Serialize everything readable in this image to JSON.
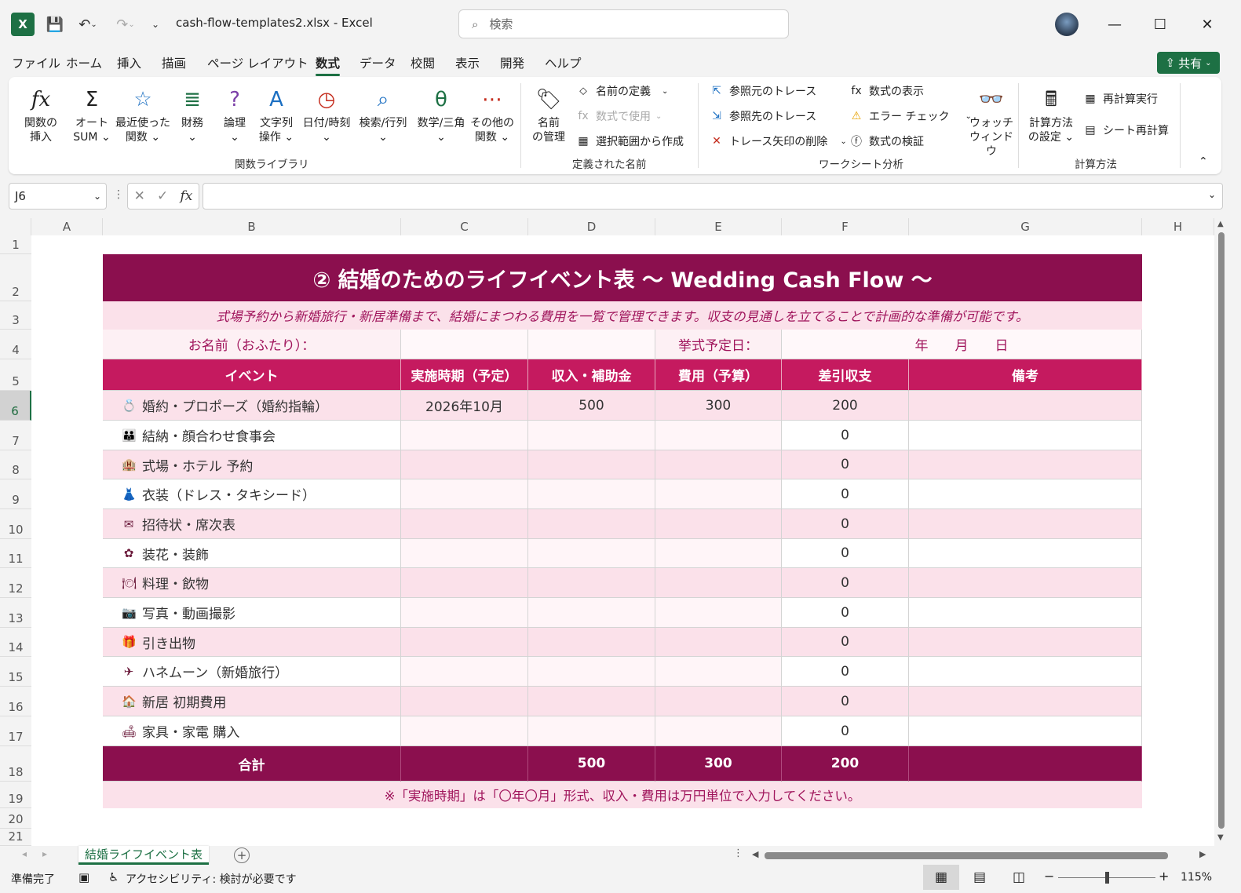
{
  "titlebar": {
    "file_title": "cash-flow-templates2.xlsx  -  Excel",
    "search_placeholder": "検索"
  },
  "menu": {
    "items": [
      "ファイル",
      "ホーム",
      "挿入",
      "描画",
      "ページ レイアウト",
      "数式",
      "データ",
      "校閲",
      "表示",
      "開発",
      "ヘルプ"
    ],
    "active": "数式",
    "share": "共有"
  },
  "ribbon": {
    "insert_function": [
      "関数の",
      "挿入"
    ],
    "autosum": [
      "オート",
      "SUM"
    ],
    "recent": [
      "最近使った",
      "関数"
    ],
    "financial": "財務",
    "logical": "論理",
    "text": [
      "文字列",
      "操作"
    ],
    "datetime": "日付/時刻",
    "lookup": "検索/行列",
    "math": "数学/三角",
    "more": [
      "その他の",
      "関数"
    ],
    "group_library": "関数ライブラリ",
    "name_manager": [
      "名前",
      "の管理"
    ],
    "define_name": "名前の定義",
    "use_in_formula": "数式で使用",
    "create_from_sel": "選択範囲から作成",
    "group_names": "定義された名前",
    "trace_precedents": "参照元のトレース",
    "trace_dependents": "参照先のトレース",
    "remove_arrows": "トレース矢印の削除",
    "show_formulas": "数式の表示",
    "error_check": "エラー チェック",
    "evaluate": "数式の検証",
    "watch": [
      "ウォッチ",
      "ウィンドウ"
    ],
    "group_audit": "ワークシート分析",
    "calc_options": [
      "計算方法",
      "の設定"
    ],
    "calc_now": "再計算実行",
    "calc_sheet": "シート再計算",
    "group_calc": "計算方法"
  },
  "formula_bar": {
    "name_box": "J6",
    "fx": "fx"
  },
  "columns": [
    "A",
    "B",
    "C",
    "D",
    "E",
    "F",
    "G",
    "H"
  ],
  "rows": [
    "1",
    "2",
    "3",
    "4",
    "5",
    "6",
    "7",
    "8",
    "9",
    "10",
    "11",
    "12",
    "13",
    "14",
    "15",
    "16",
    "17",
    "18",
    "19",
    "20",
    "21"
  ],
  "sheet": {
    "title": "② 結婚のためのライフイベント表 〜 Wedding Cash Flow 〜",
    "subtitle": "式場予約から新婚旅行・新居準備まで、結婚にまつわる費用を一覧で管理できます。収支の見通しを立てることで計画的な準備が可能です。",
    "name_label": "お名前（おふたり）：",
    "date_label": "挙式予定日：",
    "date_value": "年　　月　　日",
    "headers": [
      "イベント",
      "実施時期（予定）",
      "収入・補助金",
      "費用（予算）",
      "差引収支",
      "備考"
    ],
    "events": [
      {
        "icon": "💍",
        "name": "婚約・プロポーズ（婚約指輪）",
        "when": "2026年10月",
        "income": "500",
        "cost": "300",
        "balance": "200"
      },
      {
        "icon": "👪",
        "name": "結納・顔合わせ食事会",
        "when": "",
        "income": "",
        "cost": "",
        "balance": "0"
      },
      {
        "icon": "🏨",
        "name": "式場・ホテル 予約",
        "when": "",
        "income": "",
        "cost": "",
        "balance": "0"
      },
      {
        "icon": "👗",
        "name": "衣装（ドレス・タキシード）",
        "when": "",
        "income": "",
        "cost": "",
        "balance": "0"
      },
      {
        "icon": "✉",
        "name": "招待状・席次表",
        "when": "",
        "income": "",
        "cost": "",
        "balance": "0"
      },
      {
        "icon": "✿",
        "name": "装花・装飾",
        "when": "",
        "income": "",
        "cost": "",
        "balance": "0"
      },
      {
        "icon": "🍽",
        "name": "料理・飲物",
        "when": "",
        "income": "",
        "cost": "",
        "balance": "0"
      },
      {
        "icon": "📷",
        "name": "写真・動画撮影",
        "when": "",
        "income": "",
        "cost": "",
        "balance": "0"
      },
      {
        "icon": "🎁",
        "name": "引き出物",
        "when": "",
        "income": "",
        "cost": "",
        "balance": "0"
      },
      {
        "icon": "✈",
        "name": "ハネムーン（新婚旅行）",
        "when": "",
        "income": "",
        "cost": "",
        "balance": "0"
      },
      {
        "icon": "🏠",
        "name": "新居 初期費用",
        "when": "",
        "income": "",
        "cost": "",
        "balance": "0"
      },
      {
        "icon": "🛋",
        "name": "家具・家電 購入",
        "when": "",
        "income": "",
        "cost": "",
        "balance": "0"
      }
    ],
    "total": {
      "label": "合計",
      "income": "500",
      "cost": "300",
      "balance": "200"
    },
    "note": "※「実施時期」は「〇年〇月」形式、収入・費用は万円単位で入力してください。"
  },
  "tabs": {
    "sheet_tab": "結婚ライフイベント表"
  },
  "status": {
    "ready": "準備完了",
    "accessibility": "アクセシビリティ: 検討が必要です",
    "zoom": "115%"
  },
  "colors": {
    "excel_green": "#1d7044",
    "title_band": "#8b0f4e",
    "header": "#c51a5f",
    "light_pink": "#fbe1ea"
  }
}
